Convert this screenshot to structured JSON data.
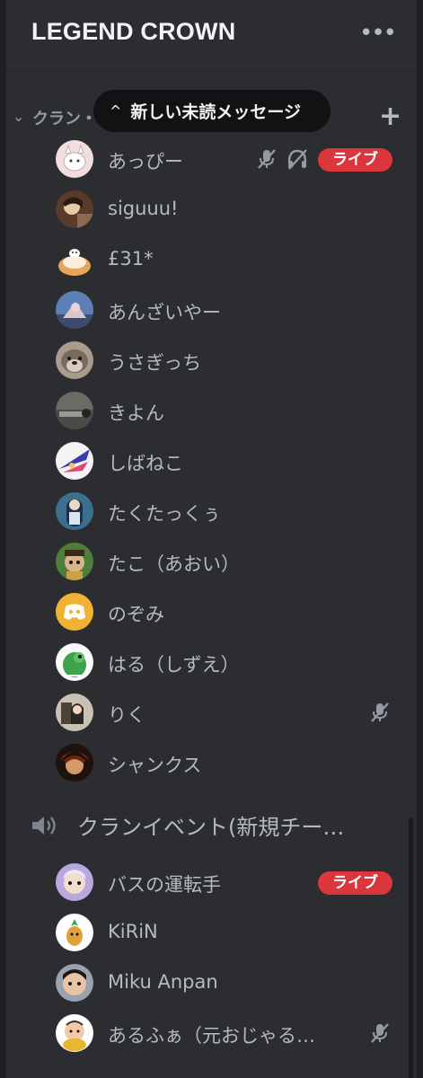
{
  "header": {
    "server_name": "LEGEND CROWN",
    "more_icon": "•••"
  },
  "category": {
    "chevron": "⌄",
    "label": "クラン・",
    "add_icon": "+"
  },
  "unread_banner": {
    "chevron": "^",
    "text": "新しい未読メッセージ"
  },
  "members_a": [
    {
      "name": "あっぴー",
      "live": "ライブ",
      "muted": true,
      "deafened": true
    },
    {
      "name": "siguuu!"
    },
    {
      "name": "£31*"
    },
    {
      "name": "あんざいやー"
    },
    {
      "name": "うさぎっち"
    },
    {
      "name": "きよん"
    },
    {
      "name": "しばねこ"
    },
    {
      "name": "たくたっくぅ"
    },
    {
      "name": "たこ（あおい）"
    },
    {
      "name": "のぞみ"
    },
    {
      "name": "はる（しずえ）"
    },
    {
      "name": "りく",
      "muted": true
    },
    {
      "name": "シャンクス"
    }
  ],
  "voice_channel": {
    "icon": "speaker-icon",
    "name": "クランイベント(新規チー…"
  },
  "members_b": [
    {
      "name": "バスの運転手",
      "live": "ライブ"
    },
    {
      "name": "KiRiN"
    },
    {
      "name": "Miku Anpan"
    },
    {
      "name": "あるふぁ（元おじゃる…",
      "muted": true
    }
  ],
  "colors": {
    "background": "#2b2d31",
    "live_red": "#da373c",
    "text_muted": "#b5bac1",
    "discord_orange": "#f0b232"
  }
}
